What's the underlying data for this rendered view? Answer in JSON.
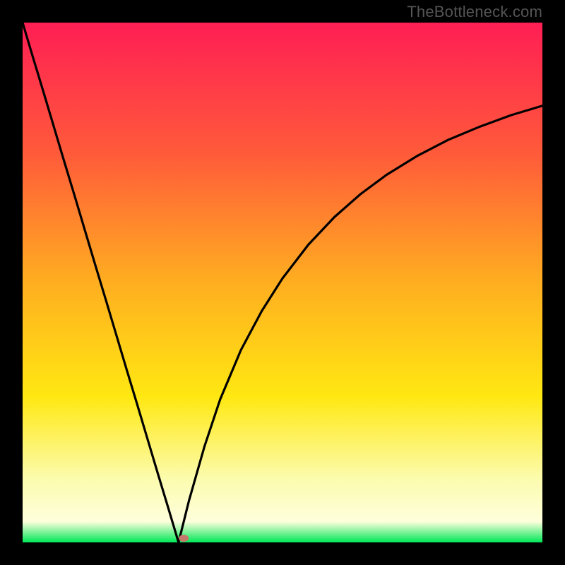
{
  "attribution": "TheBottleneck.com",
  "chart_data": {
    "type": "line",
    "title": "",
    "xlabel": "",
    "ylabel": "",
    "xlim": [
      0,
      100
    ],
    "ylim": [
      0,
      100
    ],
    "grid": false,
    "gradient_stops": [
      {
        "pos": 0.0,
        "color": "#ff1e54"
      },
      {
        "pos": 0.25,
        "color": "#ff5a3a"
      },
      {
        "pos": 0.5,
        "color": "#ffae20"
      },
      {
        "pos": 0.72,
        "color": "#ffe812"
      },
      {
        "pos": 0.88,
        "color": "#fcfcb0"
      },
      {
        "pos": 0.96,
        "color": "#fefedc"
      },
      {
        "pos": 1.0,
        "color": "#00e858"
      }
    ],
    "x_v_min": 30,
    "marker": {
      "x": 31,
      "y": 0.8,
      "color": "#c47a6a"
    },
    "series": [
      {
        "name": "left-branch",
        "x": [
          0,
          2,
          4,
          6,
          8,
          10,
          12,
          14,
          16,
          18,
          20,
          22,
          24,
          26,
          28,
          30
        ],
        "y": [
          100,
          93.3,
          86.7,
          80.0,
          73.3,
          66.7,
          60.0,
          53.3,
          46.7,
          40.0,
          33.3,
          26.7,
          20.0,
          13.3,
          6.7,
          0.0
        ]
      },
      {
        "name": "right-branch",
        "x": [
          30,
          32,
          35,
          38,
          42,
          46,
          50,
          55,
          60,
          65,
          70,
          76,
          82,
          88,
          94,
          100
        ],
        "y": [
          0.0,
          8.0,
          18.5,
          27.5,
          37.0,
          44.5,
          50.8,
          57.3,
          62.6,
          67.0,
          70.7,
          74.4,
          77.5,
          80.0,
          82.2,
          84.0
        ]
      }
    ]
  }
}
